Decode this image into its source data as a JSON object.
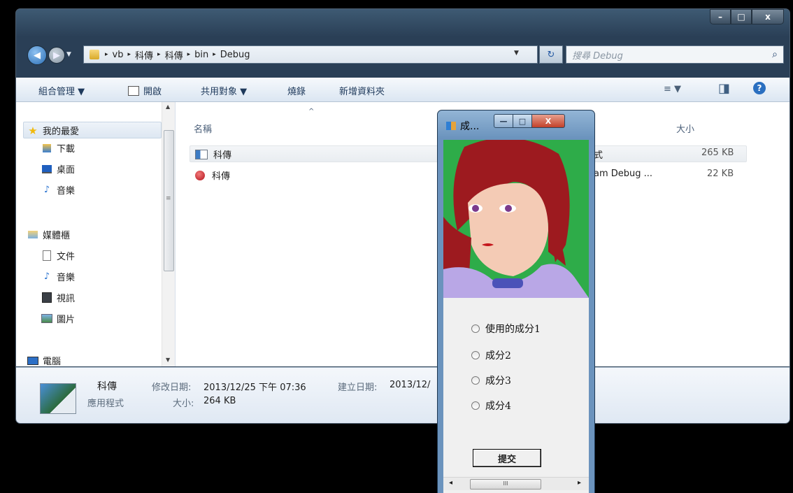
{
  "explorer": {
    "caption_buttons": {
      "minimize": "–",
      "maximize": "□",
      "close": "x"
    },
    "back_arrow": "◀",
    "forward_arrow": "▶",
    "nav_dropdown": "▼",
    "address": {
      "crumbs": [
        "vb",
        "科傳",
        "科傳",
        "bin",
        "Debug"
      ],
      "separator": "▸",
      "dropdown": "▼",
      "refresh": "↻"
    },
    "search": {
      "placeholder": "搜尋 Debug",
      "icon": "⌕"
    },
    "toolbar": {
      "organize": "組合管理 ▼",
      "open": "開啟",
      "share": "共用對象 ▼",
      "burn": "燒錄",
      "new_folder": "新增資料夾",
      "view_icon": "≡ ▼",
      "pane_icon": "◨",
      "help_icon": "?"
    },
    "nav": {
      "favorites": {
        "label": "我的最愛",
        "icon": "★"
      },
      "fav_items": [
        {
          "label": "下載",
          "icon": "download-folder-icon"
        },
        {
          "label": "桌面",
          "icon": "desktop-icon"
        },
        {
          "label": "音樂",
          "icon": "music-icon"
        }
      ],
      "libraries": {
        "label": "媒體櫃",
        "icon": "library-icon"
      },
      "lib_items": [
        {
          "label": "文件",
          "icon": "document-icon"
        },
        {
          "label": "音樂",
          "icon": "music-icon"
        },
        {
          "label": "視訊",
          "icon": "video-icon"
        },
        {
          "label": "圖片",
          "icon": "picture-icon"
        }
      ],
      "computer": {
        "label": "電腦",
        "icon": "computer-icon"
      },
      "scroll_up": "▲",
      "scroll_down": "▼",
      "thumb_grip": "≡"
    },
    "columns": {
      "name": "名稱",
      "sort_indicator": "^",
      "size": "大小"
    },
    "files": [
      {
        "name": "科傳",
        "type_fragment": "式",
        "size": "265 KB",
        "icon": "application-icon"
      },
      {
        "name": "科傳",
        "type_fragment": "am Debug ...",
        "size": "22 KB",
        "icon": "debug-database-icon"
      }
    ],
    "details": {
      "name": "科傳",
      "type": "應用程式",
      "modified_label": "修改日期:",
      "modified_value": "2013/12/25 下午 07:36",
      "created_label": "建立日期:",
      "created_value": "2013/12/",
      "size_label": "大小:",
      "size_value": "264 KB"
    }
  },
  "form": {
    "title": "成...",
    "buttons": {
      "minimize": "—",
      "maximize": "□",
      "close": "X"
    },
    "options": [
      "使用的成分1",
      "成分2",
      "成分3",
      "成分4"
    ],
    "submit": "提交",
    "hscroll": {
      "left": "◂",
      "right": "▸",
      "grip": "III"
    }
  }
}
